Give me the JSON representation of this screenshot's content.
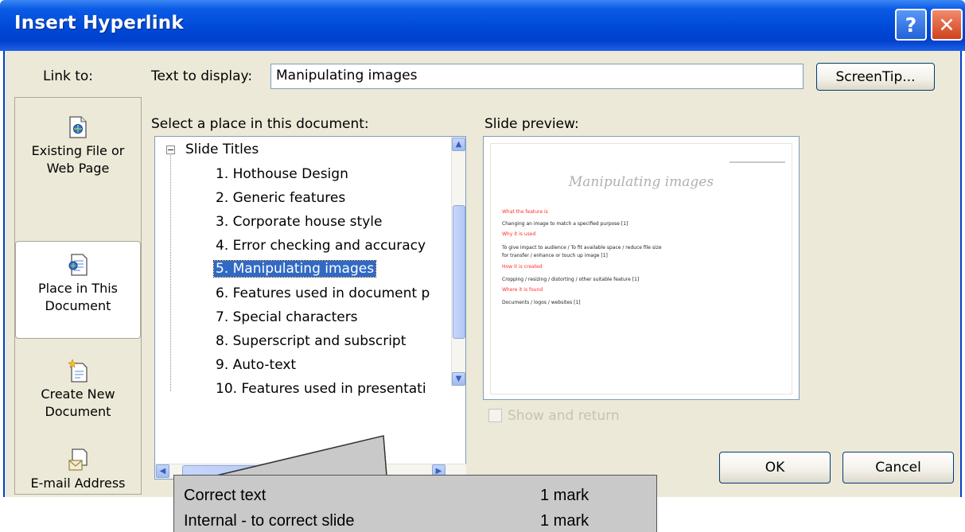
{
  "dialog": {
    "title": "Insert Hyperlink",
    "help_label": "?",
    "close_label": "✕"
  },
  "link_to": {
    "heading": "Link to:",
    "items": [
      {
        "label_line1": "Existing File or",
        "label_line2": "Web Page",
        "icon": "existing-file-icon"
      },
      {
        "label_line1": "Place in This",
        "label_line2": "Document",
        "icon": "place-in-document-icon",
        "selected": true
      },
      {
        "label_line1": "Create New",
        "label_line2": "Document",
        "icon": "create-new-document-icon"
      },
      {
        "label_line1": "E-mail Address",
        "label_line2": "",
        "icon": "email-address-icon"
      }
    ]
  },
  "text_to_display": {
    "label": "Text to display:",
    "value": "Manipulating images"
  },
  "screentip_label": "ScreenTip...",
  "place_in_document": {
    "label": "Select a place in this document:",
    "root": "Slide Titles",
    "items": [
      "1. Hothouse Design",
      "2. Generic features",
      "3. Corporate house style",
      "4. Error checking and accuracy",
      "5. Manipulating images",
      "6. Features used in document p",
      "7. Special characters",
      "8. Superscript and subscript",
      "9. Auto-text",
      "10. Features used in presentati"
    ],
    "selected_index": 4
  },
  "slide_preview": {
    "label": "Slide preview:",
    "title": "Manipulating images",
    "lines": [
      {
        "text": "What the feature is",
        "color": "red"
      },
      {
        "text": "Changing an image to match a specified purpose                     [1]",
        "color": "black"
      },
      {
        "text": "Why it is used",
        "color": "red"
      },
      {
        "text": "To give impact to audience / To fit available space / reduce file size",
        "color": "black"
      },
      {
        "text": "for transfer / enhance or touch up image                                 [1]",
        "color": "black"
      },
      {
        "text": "How it is created",
        "color": "red"
      },
      {
        "text": "Cropping / resizing / distorting / other suitable feature        [1]",
        "color": "black"
      },
      {
        "text": "Where it is found",
        "color": "red"
      },
      {
        "text": "Documents / logos / websites                                        [1]",
        "color": "black"
      }
    ]
  },
  "show_and_return": {
    "label": "Show and return",
    "checked": false,
    "enabled": false
  },
  "buttons": {
    "ok": "OK",
    "cancel": "Cancel"
  },
  "annotation": {
    "rows": [
      {
        "label": "Correct text",
        "marks": "1 mark"
      },
      {
        "label": "Internal - to correct slide",
        "marks": "1 mark"
      }
    ]
  }
}
